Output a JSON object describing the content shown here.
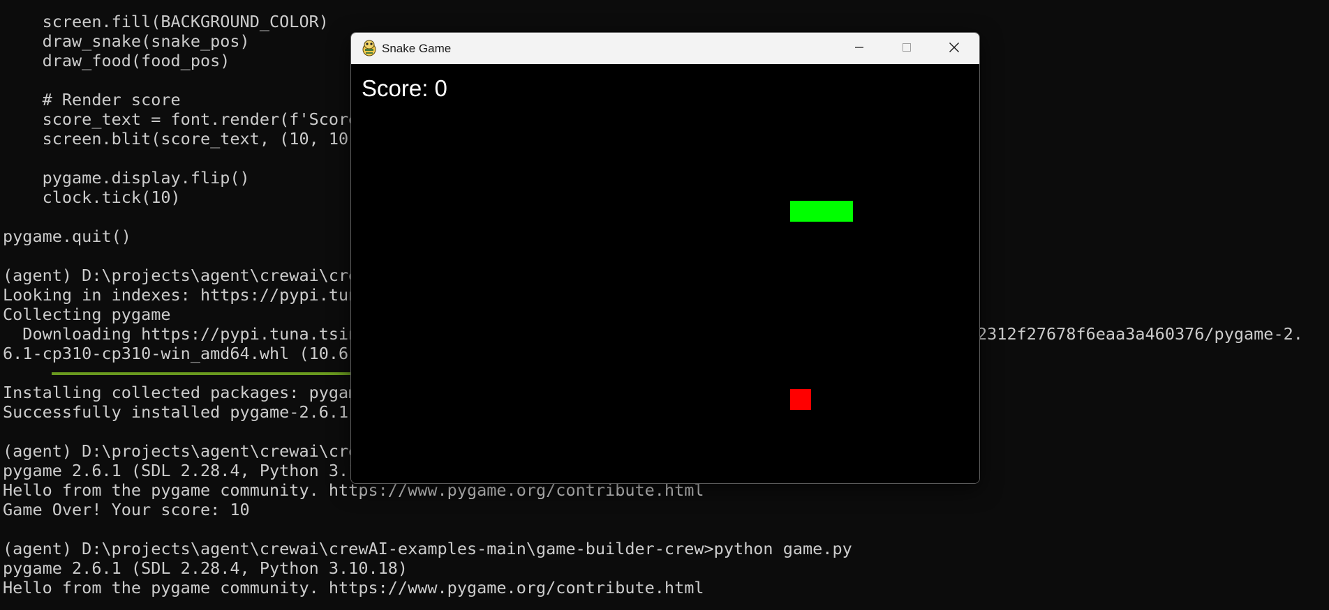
{
  "terminal": {
    "lines": [
      "    screen.fill(BACKGROUND_COLOR)",
      "    draw_snake(snake_pos)",
      "    draw_food(food_pos)",
      "",
      "    # Render score",
      "    score_text = font.render(f'Score",
      "    screen.blit(score_text, (10, 10)",
      "",
      "    pygame.display.flip()",
      "    clock.tick(10)",
      "",
      "pygame.quit()",
      "",
      "(agent) D:\\projects\\agent\\crewai\\cre",
      "Looking in indexes: https://pypi.tun",
      "Collecting pygame",
      "  Downloading https://pypi.tuna.tsin",
      "6.1-cp310-cp310-win_amd64.whl (10.6",
      "",
      "Installing collected packages: pygam",
      "Successfully installed pygame-2.6.1",
      "",
      "(agent) D:\\projects\\agent\\crewai\\cre",
      "pygame 2.6.1 (SDL 2.28.4, Python 3.1",
      "Hello from the pygame community. https://www.pygame.org/contribute.html",
      "Game Over! Your score: 10",
      "",
      "(agent) D:\\projects\\agent\\crewai\\crewAI-examples-main\\game-builder-crew>python game.py",
      "pygame 2.6.1 (SDL 2.28.4, Python 3.10.18)",
      "Hello from the pygame community. https://www.pygame.org/contribute.html"
    ],
    "download_url_tail": "2312f27678f6eaa3a460376/pygame-2."
  },
  "game_window": {
    "title": "Snake Game",
    "icon": "pygame-snake-icon",
    "score_text": "Score: 0",
    "minimize_icon": "minimize-icon",
    "maximize_icon": "maximize-icon",
    "close_icon": "close-icon"
  },
  "colors": {
    "terminal_bg": "#0c0c0c",
    "terminal_fg": "#cccccc",
    "snake": "#00ff00",
    "food": "#ff0000",
    "game_bg": "#000000",
    "titlebar_bg": "#f3f3f3",
    "progress": "#6a9a1f"
  }
}
